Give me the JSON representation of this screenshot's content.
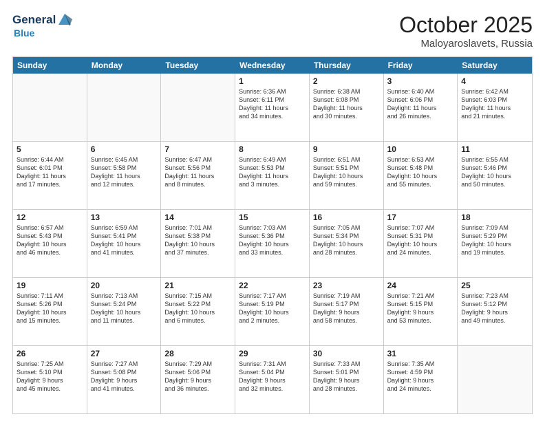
{
  "header": {
    "logo": {
      "general": "General",
      "blue": "Blue"
    },
    "title": "October 2025",
    "location": "Maloyaroslavets, Russia"
  },
  "dayHeaders": [
    "Sunday",
    "Monday",
    "Tuesday",
    "Wednesday",
    "Thursday",
    "Friday",
    "Saturday"
  ],
  "weeks": [
    [
      {
        "day": "",
        "info": ""
      },
      {
        "day": "",
        "info": ""
      },
      {
        "day": "",
        "info": ""
      },
      {
        "day": "1",
        "info": "Sunrise: 6:36 AM\nSunset: 6:11 PM\nDaylight: 11 hours\nand 34 minutes."
      },
      {
        "day": "2",
        "info": "Sunrise: 6:38 AM\nSunset: 6:08 PM\nDaylight: 11 hours\nand 30 minutes."
      },
      {
        "day": "3",
        "info": "Sunrise: 6:40 AM\nSunset: 6:06 PM\nDaylight: 11 hours\nand 26 minutes."
      },
      {
        "day": "4",
        "info": "Sunrise: 6:42 AM\nSunset: 6:03 PM\nDaylight: 11 hours\nand 21 minutes."
      }
    ],
    [
      {
        "day": "5",
        "info": "Sunrise: 6:44 AM\nSunset: 6:01 PM\nDaylight: 11 hours\nand 17 minutes."
      },
      {
        "day": "6",
        "info": "Sunrise: 6:45 AM\nSunset: 5:58 PM\nDaylight: 11 hours\nand 12 minutes."
      },
      {
        "day": "7",
        "info": "Sunrise: 6:47 AM\nSunset: 5:56 PM\nDaylight: 11 hours\nand 8 minutes."
      },
      {
        "day": "8",
        "info": "Sunrise: 6:49 AM\nSunset: 5:53 PM\nDaylight: 11 hours\nand 3 minutes."
      },
      {
        "day": "9",
        "info": "Sunrise: 6:51 AM\nSunset: 5:51 PM\nDaylight: 10 hours\nand 59 minutes."
      },
      {
        "day": "10",
        "info": "Sunrise: 6:53 AM\nSunset: 5:48 PM\nDaylight: 10 hours\nand 55 minutes."
      },
      {
        "day": "11",
        "info": "Sunrise: 6:55 AM\nSunset: 5:46 PM\nDaylight: 10 hours\nand 50 minutes."
      }
    ],
    [
      {
        "day": "12",
        "info": "Sunrise: 6:57 AM\nSunset: 5:43 PM\nDaylight: 10 hours\nand 46 minutes."
      },
      {
        "day": "13",
        "info": "Sunrise: 6:59 AM\nSunset: 5:41 PM\nDaylight: 10 hours\nand 41 minutes."
      },
      {
        "day": "14",
        "info": "Sunrise: 7:01 AM\nSunset: 5:38 PM\nDaylight: 10 hours\nand 37 minutes."
      },
      {
        "day": "15",
        "info": "Sunrise: 7:03 AM\nSunset: 5:36 PM\nDaylight: 10 hours\nand 33 minutes."
      },
      {
        "day": "16",
        "info": "Sunrise: 7:05 AM\nSunset: 5:34 PM\nDaylight: 10 hours\nand 28 minutes."
      },
      {
        "day": "17",
        "info": "Sunrise: 7:07 AM\nSunset: 5:31 PM\nDaylight: 10 hours\nand 24 minutes."
      },
      {
        "day": "18",
        "info": "Sunrise: 7:09 AM\nSunset: 5:29 PM\nDaylight: 10 hours\nand 19 minutes."
      }
    ],
    [
      {
        "day": "19",
        "info": "Sunrise: 7:11 AM\nSunset: 5:26 PM\nDaylight: 10 hours\nand 15 minutes."
      },
      {
        "day": "20",
        "info": "Sunrise: 7:13 AM\nSunset: 5:24 PM\nDaylight: 10 hours\nand 11 minutes."
      },
      {
        "day": "21",
        "info": "Sunrise: 7:15 AM\nSunset: 5:22 PM\nDaylight: 10 hours\nand 6 minutes."
      },
      {
        "day": "22",
        "info": "Sunrise: 7:17 AM\nSunset: 5:19 PM\nDaylight: 10 hours\nand 2 minutes."
      },
      {
        "day": "23",
        "info": "Sunrise: 7:19 AM\nSunset: 5:17 PM\nDaylight: 9 hours\nand 58 minutes."
      },
      {
        "day": "24",
        "info": "Sunrise: 7:21 AM\nSunset: 5:15 PM\nDaylight: 9 hours\nand 53 minutes."
      },
      {
        "day": "25",
        "info": "Sunrise: 7:23 AM\nSunset: 5:12 PM\nDaylight: 9 hours\nand 49 minutes."
      }
    ],
    [
      {
        "day": "26",
        "info": "Sunrise: 7:25 AM\nSunset: 5:10 PM\nDaylight: 9 hours\nand 45 minutes."
      },
      {
        "day": "27",
        "info": "Sunrise: 7:27 AM\nSunset: 5:08 PM\nDaylight: 9 hours\nand 41 minutes."
      },
      {
        "day": "28",
        "info": "Sunrise: 7:29 AM\nSunset: 5:06 PM\nDaylight: 9 hours\nand 36 minutes."
      },
      {
        "day": "29",
        "info": "Sunrise: 7:31 AM\nSunset: 5:04 PM\nDaylight: 9 hours\nand 32 minutes."
      },
      {
        "day": "30",
        "info": "Sunrise: 7:33 AM\nSunset: 5:01 PM\nDaylight: 9 hours\nand 28 minutes."
      },
      {
        "day": "31",
        "info": "Sunrise: 7:35 AM\nSunset: 4:59 PM\nDaylight: 9 hours\nand 24 minutes."
      },
      {
        "day": "",
        "info": ""
      }
    ]
  ]
}
